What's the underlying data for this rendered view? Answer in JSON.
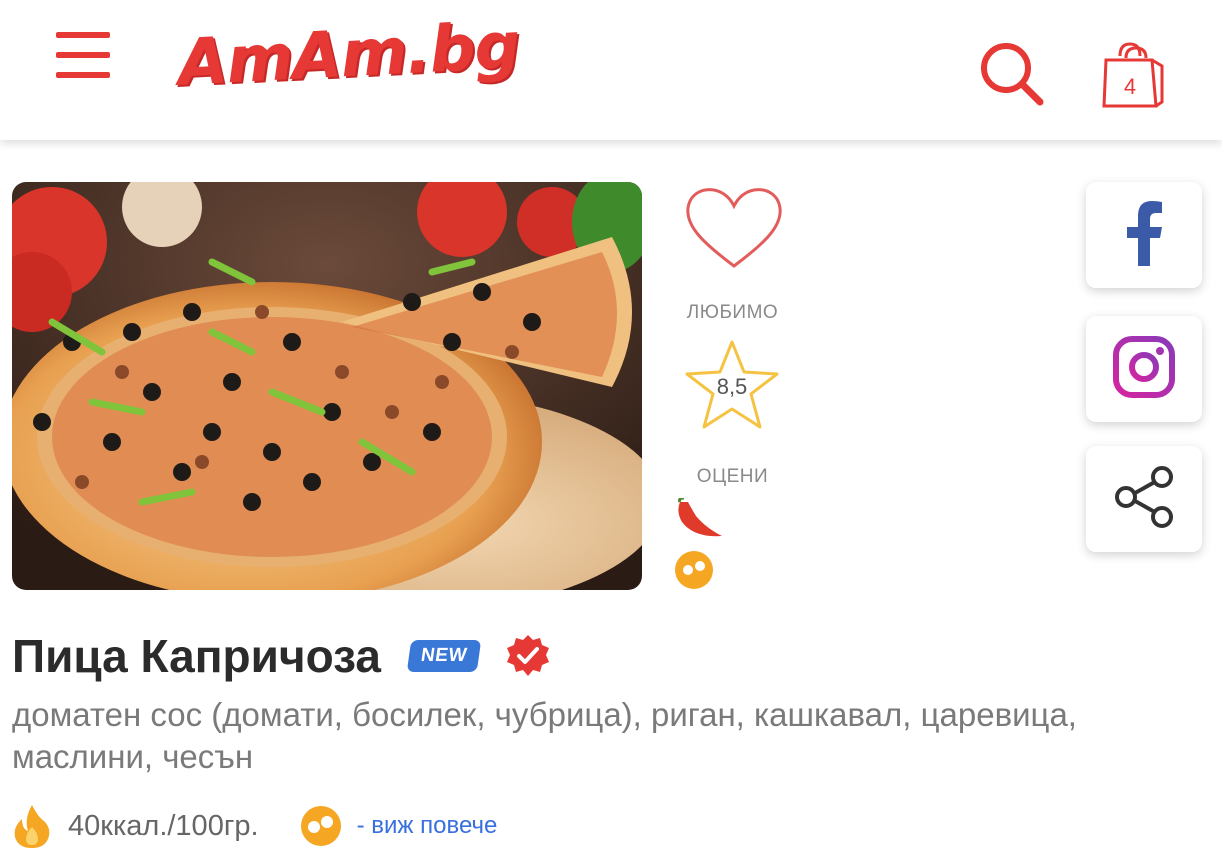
{
  "header": {
    "menu_icon": "hamburger-icon",
    "logo_text": "AmAm.bg",
    "search_icon": "search-icon",
    "cart_icon": "shopping-bag-icon",
    "cart_count": "4"
  },
  "product": {
    "image_alt": "pizza-photo",
    "favorite_label": "ЛЮБИМО",
    "rating_value": "8,5",
    "rate_label": "ОЦЕНИ",
    "spicy_icon": "chili-pepper-icon",
    "info_icon": "orange-dots-icon",
    "title": "Пица Капричоза",
    "badge": "NEW",
    "verified_icon": "verified-check-icon",
    "description": "доматен сос (домати, босилек, чубрица), риган, кашкавал, царевица, маслини, чесън",
    "calories": "40ккал./100гр.",
    "more_link": "- виж повече"
  },
  "social": {
    "facebook_icon": "facebook-icon",
    "instagram_icon": "instagram-icon",
    "share_icon": "share-icon"
  },
  "colors": {
    "brand_red": "#e63935",
    "badge_blue": "#3a78d8",
    "link_blue": "#3a6fe0",
    "star_yellow": "#f5c242",
    "orange": "#f5a623"
  }
}
